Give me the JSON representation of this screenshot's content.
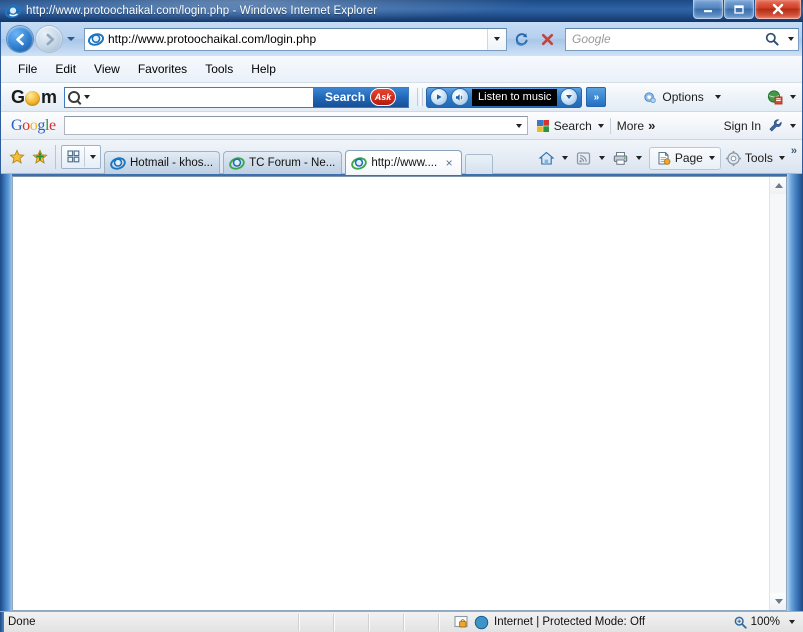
{
  "window": {
    "title": "http://www.protoochaikal.com/login.php - Windows Internet Explorer",
    "minimize_label": "Minimize",
    "maximize_label": "Maximize",
    "close_label": "Close",
    "app_icon": "internet-explorer-icon"
  },
  "address_bar": {
    "back_label": "Back",
    "forward_label": "Forward",
    "history_label": "Recent Pages",
    "url": "http://www.protoochaikal.com/login.php",
    "url_icon": "internet-explorer-icon",
    "refresh_label": "Refresh",
    "stop_label": "Stop",
    "search_placeholder": "Google",
    "search_value": "",
    "search_icon": "magnifier-icon",
    "search_dropdown_label": "Change search defaults"
  },
  "menu": {
    "items": [
      {
        "label": "File"
      },
      {
        "label": "Edit"
      },
      {
        "label": "View"
      },
      {
        "label": "Favorites"
      },
      {
        "label": "Tools"
      },
      {
        "label": "Help"
      }
    ]
  },
  "gom_toolbar": {
    "logo": {
      "g": "G",
      "o": "O",
      "m": "m",
      "full": "GOM"
    },
    "search_value": "",
    "search_icon": "magnifier-icon",
    "search_button": "Search",
    "ask_badge": "Ask",
    "player": {
      "play_label": "Play",
      "volume_label": "Volume",
      "display_text": "Listen to music",
      "dropdown_label": "More stations"
    },
    "chevron_label": "»",
    "options_label": "Options",
    "options_icon": "gear-icon",
    "right_icon": "gom-app-icon",
    "right_dropdown_label": "More"
  },
  "google_toolbar": {
    "logo_letters": [
      {
        "char": "G",
        "color": "#2b5fc4"
      },
      {
        "char": "o",
        "color": "#d6342a"
      },
      {
        "char": "o",
        "color": "#edba21"
      },
      {
        "char": "g",
        "color": "#2b5fc4"
      },
      {
        "char": "l",
        "color": "#29963f"
      },
      {
        "char": "e",
        "color": "#d6342a"
      }
    ],
    "search_value": "",
    "search_dropdown_label": "Search history",
    "search_button": "Search",
    "search_icon": "google-search-icon",
    "more_label": "More",
    "more_chevrons": "»",
    "signin_label": "Sign In",
    "settings_icon": "wrench-icon",
    "settings_dropdown_label": "Settings"
  },
  "tab_bar": {
    "favorites_star_icon": "star-icon",
    "add_favorite_icon": "add-to-favorites-icon",
    "quick_tabs_icon": "quick-tabs-grid-icon",
    "tab_list_label": "Tab List",
    "tabs": [
      {
        "title": "Hotmail - khos...",
        "icon": "internet-explorer-icon",
        "active": false
      },
      {
        "title": "TC Forum - Ne...",
        "icon": "internet-explorer-icon",
        "active": false
      },
      {
        "title": "http://www....",
        "icon": "internet-explorer-icon",
        "active": true,
        "close_label": "×"
      }
    ],
    "new_tab_label": "New Tab",
    "commands": [
      {
        "label": "",
        "icon": "home-icon",
        "has_dropdown": true
      },
      {
        "label": "",
        "icon": "rss-feed-icon",
        "has_dropdown": true
      },
      {
        "label": "",
        "icon": "printer-icon",
        "has_dropdown": true
      },
      {
        "label": "Page",
        "icon": "page-icon",
        "has_dropdown": true
      },
      {
        "label": "Tools",
        "icon": "tools-gear-icon",
        "has_dropdown": true
      }
    ],
    "overflow_chevrons": "»"
  },
  "page": {
    "content": "",
    "background_color": "#ffffff",
    "scrollbar": {
      "up_arrow_label": "Scroll up",
      "down_arrow_label": "Scroll down"
    }
  },
  "status_bar": {
    "status_text": "Done",
    "zone_icon": "protected-mode-icon",
    "globe_icon": "internet-zone-icon",
    "zone_text": "Internet | Protected Mode: Off",
    "zoom_icon": "magnifier-icon",
    "zoom_level": "100%",
    "zoom_dropdown_label": "Change Zoom Level"
  },
  "colors": {
    "title_bar": "#2f63a5",
    "frame_blue": "#3d79bb",
    "toolbar_bg": "#eef3f9",
    "gom_blue": "#2167b8",
    "ask_red": "#b31a10",
    "active_tab": "#ffffff",
    "status_bg": "#eaeaea"
  }
}
